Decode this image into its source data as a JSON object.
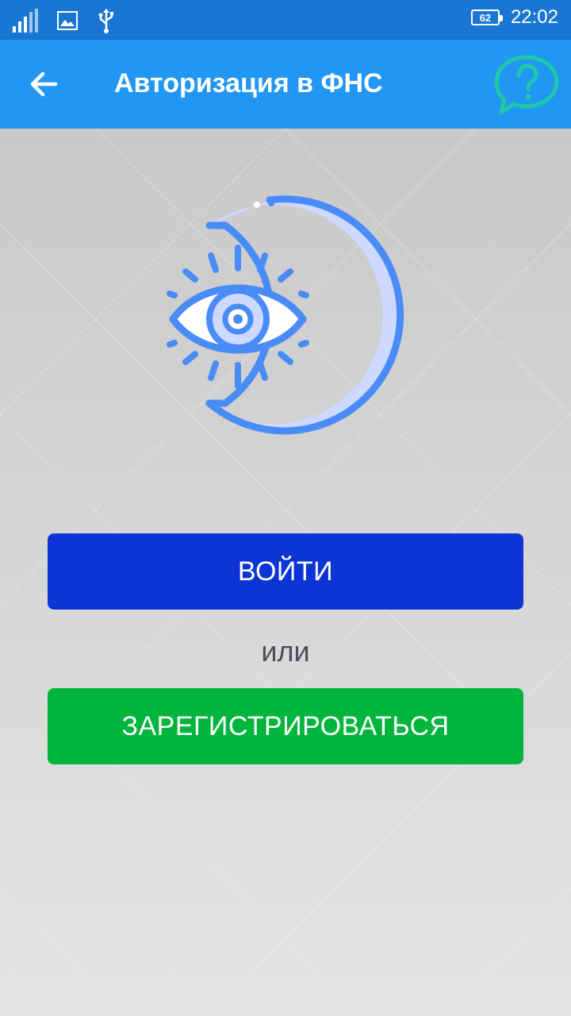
{
  "status_bar": {
    "battery_level": "62",
    "time": "22:02",
    "icons": [
      "signal-icon",
      "image-icon",
      "usb-icon",
      "battery-icon"
    ]
  },
  "app_bar": {
    "title": "Авторизация в ФНС",
    "back_icon": "arrow-left-icon",
    "help_icon": "help-chat-icon"
  },
  "hero": {
    "icon": "eye-moon-icon"
  },
  "actions": {
    "login_label": "ВОЙТИ",
    "or_label": "или",
    "register_label": "ЗАРЕГИСТРИРОВАТЬСЯ"
  },
  "colors": {
    "status_bar": "#1976d2",
    "app_bar": "#2196f3",
    "login_button": "#0d35d6",
    "register_button": "#00b53b",
    "help_icon": "#1ec9a8",
    "hero_stroke": "#4a8cf7",
    "hero_fill": "#cdd9ff"
  }
}
